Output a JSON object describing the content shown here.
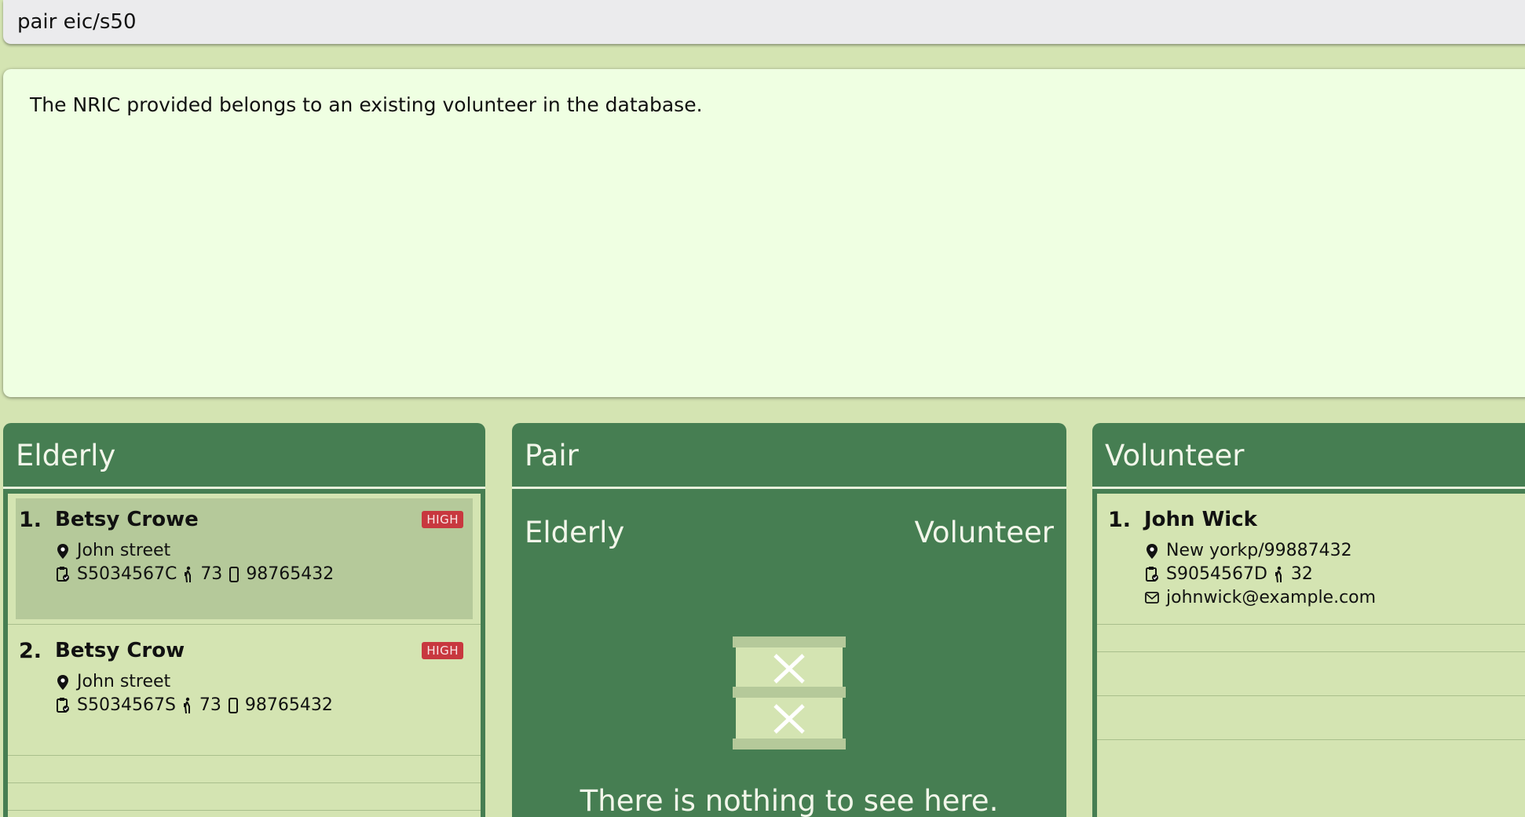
{
  "command": {
    "value": "pair eic/s50"
  },
  "result": {
    "message": "The NRIC provided belongs to an existing volunteer in the database."
  },
  "elderly_panel": {
    "title": "Elderly",
    "items": [
      {
        "index": "1.",
        "name": "Betsy Crowe",
        "priority": "HIGH",
        "address": "John street",
        "nric": "S5034567C",
        "age": "73",
        "phone": "98765432",
        "selected": true
      },
      {
        "index": "2.",
        "name": "Betsy Crow",
        "priority": "HIGH",
        "address": "John street",
        "nric": "S5034567S",
        "age": "73",
        "phone": "98765432",
        "selected": false
      }
    ]
  },
  "pair_panel": {
    "title": "Pair",
    "elderly_header": "Elderly",
    "volunteer_header": "Volunteer",
    "empty_message": "There is nothing to see here."
  },
  "volunteer_panel": {
    "title": "Volunteer",
    "items": [
      {
        "index": "1.",
        "name": "John Wick",
        "address": "New yorkp/99887432",
        "nric": "S9054567D",
        "age": "32",
        "email": "johnwick@example.com"
      }
    ]
  },
  "colors": {
    "background": "#d4e4b2",
    "panel_header": "#467e52",
    "result_background": "#efffe2",
    "badge_high": "#c8383f"
  }
}
